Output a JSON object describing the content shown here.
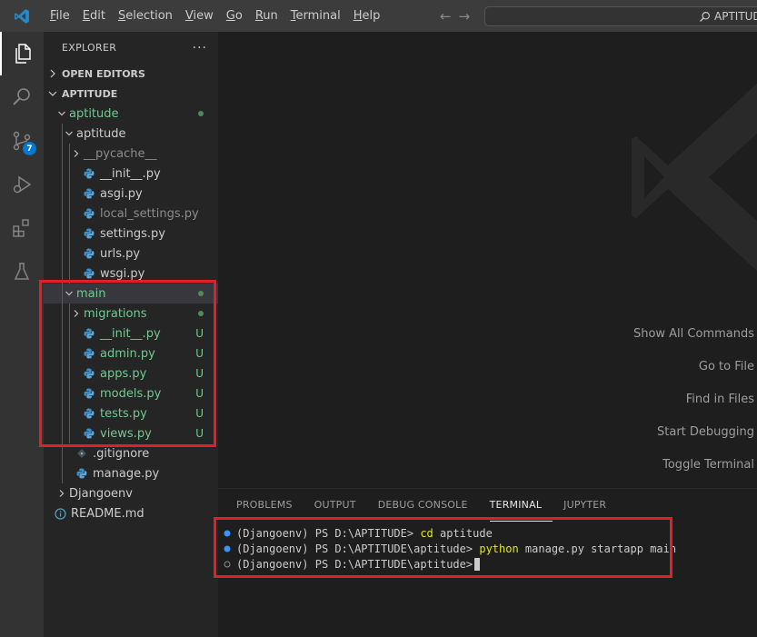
{
  "menu": [
    "File",
    "Edit",
    "Selection",
    "View",
    "Go",
    "Run",
    "Terminal",
    "Help"
  ],
  "menu_mnemonics": [
    "F",
    "E",
    "S",
    "V",
    "G",
    "R",
    "T",
    "H"
  ],
  "search": {
    "text": "APTITUDE"
  },
  "activity": {
    "scm_badge": "7"
  },
  "explorer": {
    "title": "EXPLORER",
    "more": "···",
    "open_editors": "OPEN EDITORS",
    "workspace": "APTITUDE",
    "tree": [
      {
        "label": "aptitude",
        "depth": 1,
        "type": "folder-open",
        "style": "green",
        "status": "dot"
      },
      {
        "label": "aptitude",
        "depth": 2,
        "type": "folder-open",
        "style": "normal",
        "status": ""
      },
      {
        "label": "__pycache__",
        "depth": 3,
        "type": "folder",
        "style": "dim",
        "status": ""
      },
      {
        "label": "__init__.py",
        "depth": 3,
        "type": "py",
        "style": "normal",
        "status": ""
      },
      {
        "label": "asgi.py",
        "depth": 3,
        "type": "py",
        "style": "normal",
        "status": ""
      },
      {
        "label": "local_settings.py",
        "depth": 3,
        "type": "py",
        "style": "dim",
        "status": ""
      },
      {
        "label": "settings.py",
        "depth": 3,
        "type": "py",
        "style": "normal",
        "status": ""
      },
      {
        "label": "urls.py",
        "depth": 3,
        "type": "py",
        "style": "normal",
        "status": ""
      },
      {
        "label": "wsgi.py",
        "depth": 3,
        "type": "py",
        "style": "normal",
        "status": ""
      },
      {
        "label": "main",
        "depth": 2,
        "type": "folder-open",
        "style": "green",
        "status": "dot",
        "selected": true
      },
      {
        "label": "migrations",
        "depth": 3,
        "type": "folder",
        "style": "green",
        "status": "dot"
      },
      {
        "label": "__init__.py",
        "depth": 3,
        "type": "py",
        "style": "green",
        "status": "U"
      },
      {
        "label": "admin.py",
        "depth": 3,
        "type": "py",
        "style": "green",
        "status": "U"
      },
      {
        "label": "apps.py",
        "depth": 3,
        "type": "py",
        "style": "green",
        "status": "U"
      },
      {
        "label": "models.py",
        "depth": 3,
        "type": "py",
        "style": "green",
        "status": "U"
      },
      {
        "label": "tests.py",
        "depth": 3,
        "type": "py",
        "style": "green",
        "status": "U"
      },
      {
        "label": "views.py",
        "depth": 3,
        "type": "py",
        "style": "green",
        "status": "U"
      },
      {
        "label": ".gitignore",
        "depth": 2,
        "type": "git",
        "style": "normal",
        "status": ""
      },
      {
        "label": "manage.py",
        "depth": 2,
        "type": "py",
        "style": "normal",
        "status": ""
      },
      {
        "label": "Djangoenv",
        "depth": 1,
        "type": "folder",
        "style": "normal",
        "status": ""
      },
      {
        "label": "README.md",
        "depth": 1,
        "type": "info",
        "style": "normal",
        "status": ""
      }
    ]
  },
  "editor": {
    "shortcuts": [
      "Show All Commands",
      "Go to File",
      "Find in Files",
      "Start Debugging",
      "Toggle Terminal"
    ]
  },
  "panel": {
    "tabs": [
      "PROBLEMS",
      "OUTPUT",
      "DEBUG CONSOLE",
      "TERMINAL",
      "JUPYTER"
    ],
    "active_tab": "TERMINAL",
    "terminal": [
      {
        "env": "(Djangoenv)",
        "prompt": "PS D:\\APTITUDE>",
        "cmd_highlight": "cd",
        "cmd_rest": " aptitude",
        "marker": "filled"
      },
      {
        "env": "(Djangoenv)",
        "prompt": "PS D:\\APTITUDE\\aptitude>",
        "cmd_highlight": "python",
        "cmd_rest": " manage.py startapp main",
        "marker": "filled"
      },
      {
        "env": "(Djangoenv)",
        "prompt": "PS D:\\APTITUDE\\aptitude>",
        "cmd_highlight": "",
        "cmd_rest": "",
        "marker": "hollow"
      }
    ]
  },
  "colors": {
    "accent": "#0078d4",
    "git_untracked": "#73c991",
    "highlight_box": "#e41e26",
    "command": "#e5e510"
  }
}
